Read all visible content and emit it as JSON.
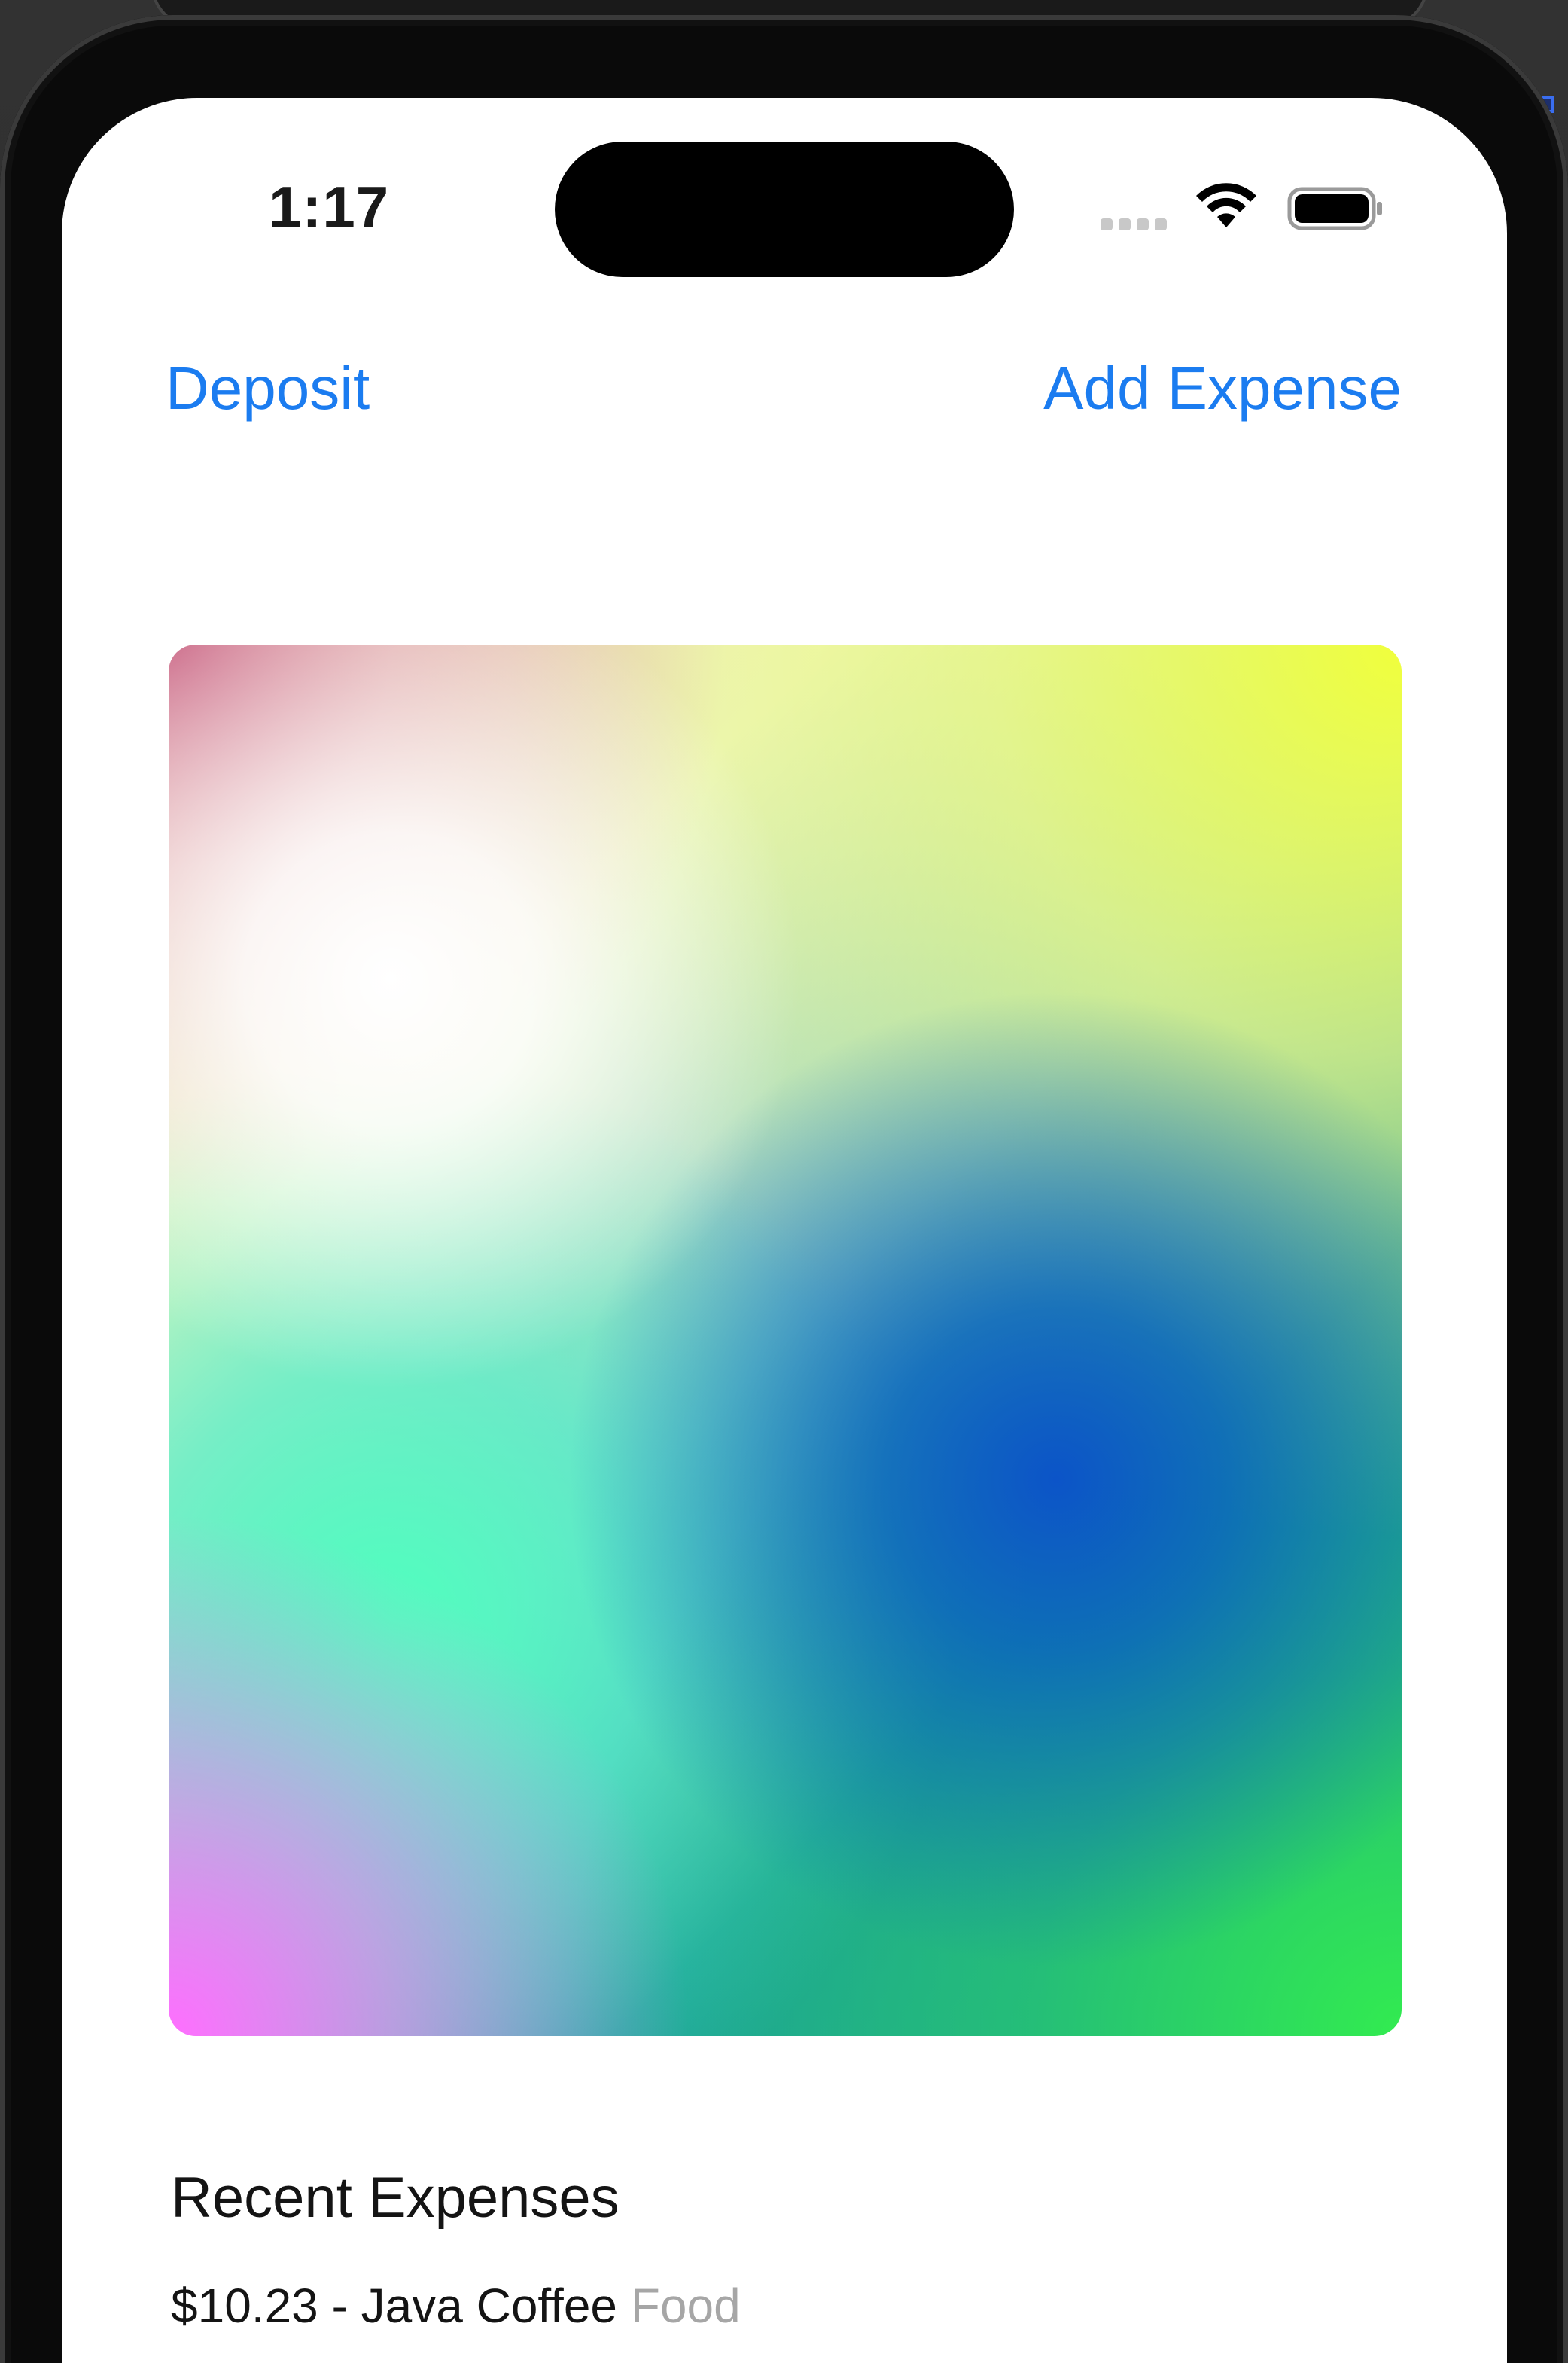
{
  "status_bar": {
    "time": "1:17"
  },
  "nav": {
    "deposit_label": "Deposit",
    "add_expense_label": "Add Expense"
  },
  "card": {
    "description": "gradient-card"
  },
  "recent_expenses": {
    "title": "Recent Expenses",
    "items": [
      {
        "amount_and_name": "$10.23 - Java Coffee",
        "category": "Food"
      }
    ]
  },
  "colors": {
    "accent": "#1b7cf0",
    "text_primary": "#141414",
    "text_secondary": "#a6a6a6",
    "background": "#ffffff"
  }
}
